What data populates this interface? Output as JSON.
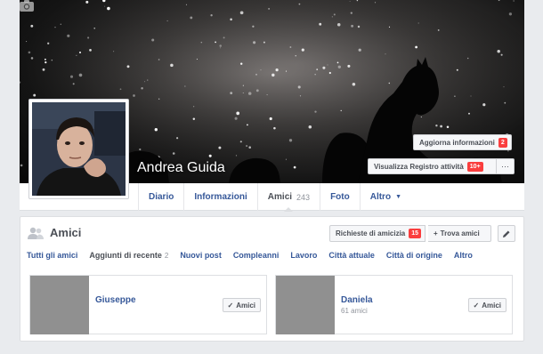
{
  "profile": {
    "name": "Andrea Guida"
  },
  "cover_actions": {
    "update_info_label": "Aggiorna informazioni",
    "update_info_badge": "2",
    "activity_log_label": "Visualizza Registro attività",
    "activity_log_badge": "10+",
    "more_label": "···"
  },
  "nav": {
    "tabs": [
      {
        "label": "Diario"
      },
      {
        "label": "Informazioni"
      },
      {
        "label": "Amici",
        "count": "243"
      },
      {
        "label": "Foto"
      },
      {
        "label": "Altro"
      }
    ]
  },
  "friends": {
    "title": "Amici",
    "requests_label": "Richieste di amicizia",
    "requests_badge": "15",
    "find_label": "Trova amici",
    "subtabs": [
      {
        "label": "Tutti gli amici"
      },
      {
        "label": "Aggiunti di recente",
        "count": "2"
      },
      {
        "label": "Nuovi post"
      },
      {
        "label": "Compleanni"
      },
      {
        "label": "Lavoro"
      },
      {
        "label": "Città attuale"
      },
      {
        "label": "Città di origine"
      },
      {
        "label": "Altro"
      }
    ],
    "cards": [
      {
        "name": "Giuseppe",
        "mutual": "",
        "button": "Amici"
      },
      {
        "name": "Daniela",
        "mutual": "61 amici",
        "button": "Amici"
      }
    ]
  },
  "icons": {
    "camera": "camera-icon",
    "friends": "friends-icon",
    "check": "check-icon",
    "plus": "plus-icon",
    "pencil": "pencil-icon",
    "caret": "caret-down-icon"
  },
  "colors": {
    "link": "#365899",
    "badge": "#fa3e3e",
    "background": "#e9ebee"
  }
}
